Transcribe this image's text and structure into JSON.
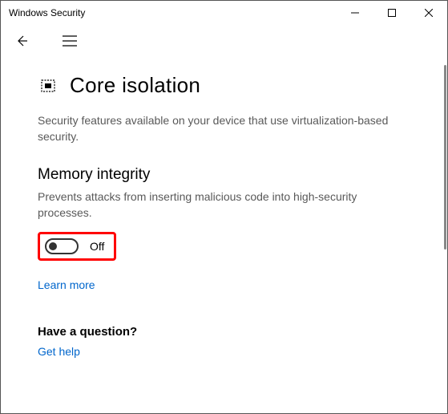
{
  "window": {
    "title": "Windows Security"
  },
  "page": {
    "heading": "Core isolation",
    "description": "Security features available on your device that use virtualization-based security."
  },
  "memory_integrity": {
    "title": "Memory integrity",
    "description": "Prevents attacks from inserting malicious code into high-security processes.",
    "toggle_state_label": "Off",
    "toggle_on": false,
    "learn_more": "Learn more"
  },
  "question": {
    "title": "Have a question?",
    "link": "Get help"
  }
}
